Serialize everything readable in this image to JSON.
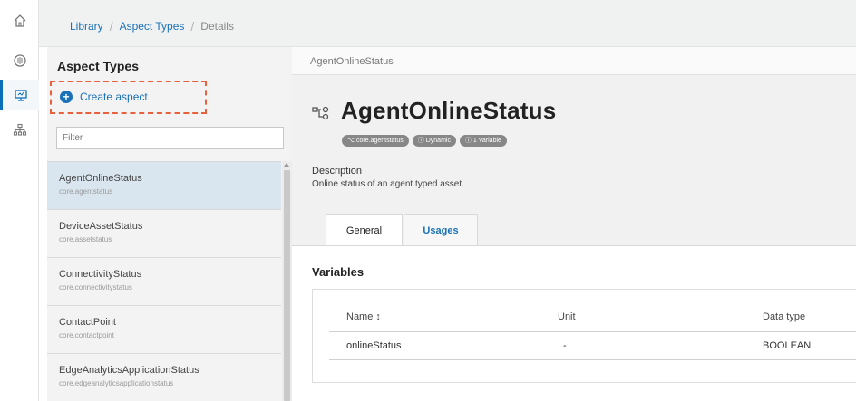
{
  "rail": {
    "icons": [
      "home-icon",
      "processor-icon",
      "monitor-icon",
      "hierarchy-icon"
    ]
  },
  "breadcrumb": {
    "items": [
      "Library",
      "Aspect Types",
      "Details"
    ]
  },
  "sidebar": {
    "title": "Aspect Types",
    "create_label": "Create aspect",
    "filter_placeholder": "Filter",
    "items": [
      {
        "name": "AgentOnlineStatus",
        "id": "core.agentstatus"
      },
      {
        "name": "DeviceAssetStatus",
        "id": "core.assetstatus"
      },
      {
        "name": "ConnectivityStatus",
        "id": "core.connectivitystatus"
      },
      {
        "name": "ContactPoint",
        "id": "core.contactpoint"
      },
      {
        "name": "EdgeAnalyticsApplicationStatus",
        "id": "core.edgeanalyticsapplicationstatus"
      }
    ]
  },
  "main": {
    "top_title": "AgentOnlineStatus",
    "title": "AgentOnlineStatus",
    "badges": [
      "⌥ core.agentstatus",
      "ⓘ Dynamic",
      "ⓘ 1 Variable"
    ],
    "description_label": "Description",
    "description_text": "Online status of an agent typed asset.",
    "tabs": [
      {
        "label": "General",
        "active": true
      },
      {
        "label": "Usages",
        "active": false
      }
    ],
    "variables": {
      "title": "Variables",
      "columns": [
        "Name ↕",
        "Unit",
        "Data type"
      ],
      "rows": [
        {
          "name": "onlineStatus",
          "unit": "-",
          "type": "BOOLEAN"
        }
      ]
    }
  },
  "colors": {
    "accent": "#1a71b8",
    "highlight_dash": "#e8603c",
    "selected_row": "#d9e6ef"
  }
}
